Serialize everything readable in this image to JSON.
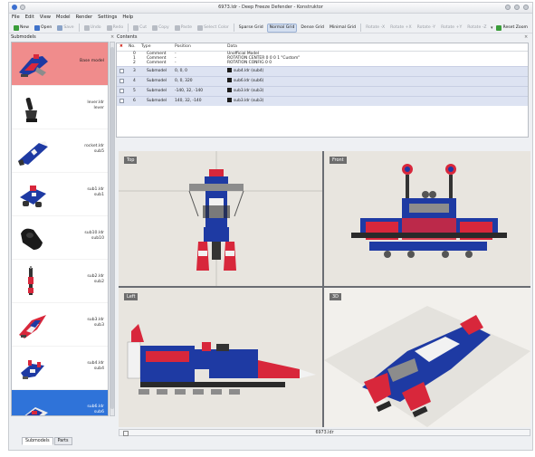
{
  "window": {
    "title": "6973.ldr - Deep Freeze Defender - Konstruktor"
  },
  "menu": [
    "File",
    "Edit",
    "View",
    "Model",
    "Render",
    "Settings",
    "Help"
  ],
  "toolbar": {
    "new": "New",
    "open": "Open",
    "save": "Save",
    "undo": "Undo",
    "redo": "Redo",
    "cut": "Cut",
    "copy": "Copy",
    "paste": "Paste",
    "select_color": "Select Color",
    "sparse_grid": "Sparse Grid",
    "normal_grid": "Normal Grid",
    "dense_grid": "Dense Grid",
    "minimal_grid": "Minimal Grid",
    "rotate_minus_x": "Rotate -X",
    "rotate_plus_x": "Rotate +X",
    "rotate_minus_y": "Rotate -Y",
    "rotate_plus_y": "Rotate +Y",
    "rotate_minus_z": "Rotate -Z",
    "reset_zoom": "Reset Zoom"
  },
  "submodels": {
    "header": "Submodels",
    "items": [
      {
        "label": "Base model"
      },
      {
        "label": "lever.ldr\nlever"
      },
      {
        "label": "rocket.ldr\nsub5"
      },
      {
        "label": "sub1.ldr\nsub1"
      },
      {
        "label": "sub10.ldr\nsub10"
      },
      {
        "label": "sub2.ldr\nsub2"
      },
      {
        "label": "sub3.ldr\nsub3"
      },
      {
        "label": "sub4.ldr\nsub4"
      },
      {
        "label": "sub6.ldr\nsub6"
      }
    ]
  },
  "tabs": {
    "submodels": "Submodels",
    "parts": "Parts"
  },
  "contents": {
    "header": "Contents",
    "columns": {
      "no": "No.",
      "type": "Type",
      "position": "Position",
      "data": "Data"
    },
    "rows": [
      {
        "no": "0",
        "type": "Comment",
        "position": "-",
        "data": "Unofficial Model"
      },
      {
        "no": "1",
        "type": "Comment",
        "position": "-",
        "data": "ROTATION CENTER 0 0 0 1 \"Custom\""
      },
      {
        "no": "2",
        "type": "Comment",
        "position": "-",
        "data": "ROTATION CONFIG 0 0"
      },
      {
        "no": "3",
        "type": "Submodel",
        "position": "0, 0, 0",
        "data": "sub4.ldr (sub4)"
      },
      {
        "no": "4",
        "type": "Submodel",
        "position": "0, 0, 320",
        "data": "sub6.ldr (sub6)"
      },
      {
        "no": "5",
        "type": "Submodel",
        "position": "-140, 32, -140",
        "data": "sub3.ldr (sub3)"
      },
      {
        "no": "6",
        "type": "Submodel",
        "position": "140, 32, -140",
        "data": "sub3.ldr (sub3)"
      }
    ]
  },
  "views": {
    "top": "Top",
    "front": "Front",
    "left": "Left",
    "3d": "3D"
  },
  "status": {
    "file": "6973.ldr"
  },
  "colors": {
    "red": "#d8273b",
    "blue": "#1e3aa3",
    "grey": "#8c8c8c",
    "white": "#f2f2f2",
    "selection": "#2f73d9",
    "base_highlight": "#f08c8c"
  }
}
